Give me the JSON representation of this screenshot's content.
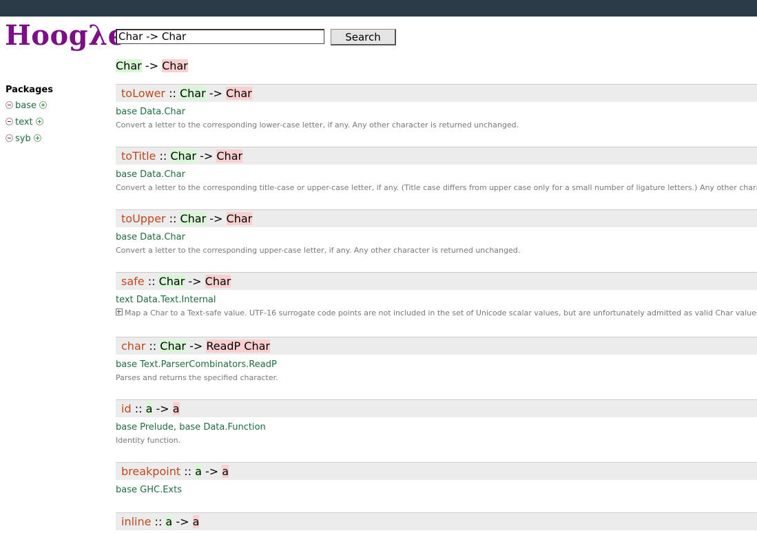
{
  "app": {
    "logo_text": "Hoogλe"
  },
  "search": {
    "query": "Char -> Char",
    "button_label": "Search"
  },
  "query_echo": {
    "arg": "Char",
    "arrow": " -> ",
    "res": "Char"
  },
  "packages": {
    "heading": "Packages",
    "items": [
      {
        "name": "base"
      },
      {
        "name": "text"
      },
      {
        "name": "syb"
      }
    ]
  },
  "results": [
    {
      "name": "toLower",
      "sep": " :: ",
      "arg": "Char",
      "arrow": " -> ",
      "res": "Char",
      "package": "base",
      "module": "Data.Char",
      "desc": "Convert a letter to the corresponding lower-case letter, if any. Any other character is returned unchanged."
    },
    {
      "name": "toTitle",
      "sep": " :: ",
      "arg": "Char",
      "arrow": " -> ",
      "res": "Char",
      "package": "base",
      "module": "Data.Char",
      "desc": "Convert a letter to the corresponding title-case or upper-case letter, if any. (Title case differs from upper case only for a small number of ligature letters.) Any other character is returned unchanged."
    },
    {
      "name": "toUpper",
      "sep": " :: ",
      "arg": "Char",
      "arrow": " -> ",
      "res": "Char",
      "package": "base",
      "module": "Data.Char",
      "desc": "Convert a letter to the corresponding upper-case letter, if any. Any other character is returned unchanged."
    },
    {
      "name": "safe",
      "sep": " :: ",
      "arg": "Char",
      "arrow": " -> ",
      "res": "Char",
      "package": "text",
      "module": "Data.Text.Internal",
      "desc": "Map a Char to a Text-safe value. UTF-16 surrogate code points are not included in the set of Unicode scalar values, but are unfortunately admitted as valid Char values by Haskell."
    },
    {
      "name": "char",
      "sep": " :: ",
      "arg": "Char",
      "arrow": " -> ",
      "res": "ReadP Char",
      "package": "base",
      "module": "Text.ParserCombinators.ReadP",
      "desc": "Parses and returns the specified character."
    },
    {
      "name": "id",
      "sep": " :: ",
      "arg": "a",
      "arrow": " -> ",
      "res": "a",
      "package": "base",
      "module": "Prelude",
      "package2": "base",
      "module2": "Data.Function",
      "desc": "Identity function."
    },
    {
      "name": "breakpoint",
      "sep": " :: ",
      "arg": "a",
      "arrow": " -> ",
      "res": "a",
      "package": "base",
      "module": "GHC.Exts"
    },
    {
      "name": "inline",
      "sep": " :: ",
      "arg": "a",
      "arrow": " -> ",
      "res": "a"
    }
  ]
}
